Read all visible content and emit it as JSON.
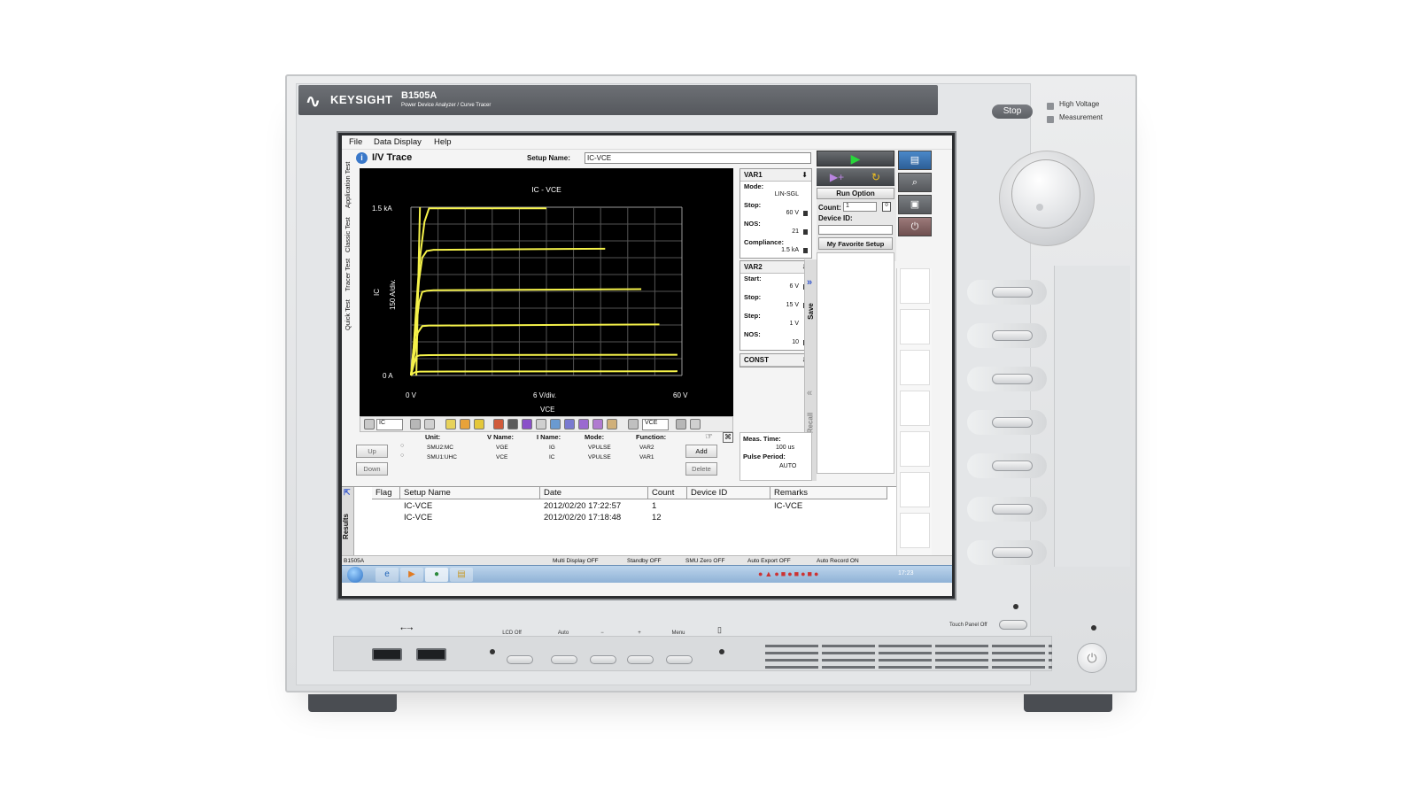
{
  "device": {
    "brand": "KEYSIGHT",
    "model": "B1505A",
    "model_desc": "Power Device Analyzer / Curve Tracer",
    "stop_label": "Stop",
    "hv_label_1": "High Voltage",
    "hv_label_2": "Measurement",
    "bottom_labels": [
      "LCD Off",
      "Auto",
      "−",
      "+",
      "Menu"
    ],
    "touch_panel_label": "Touch Panel Off",
    "usb_symbol": "⭠⭢"
  },
  "menu": [
    "File",
    "Data Display",
    "Help"
  ],
  "side_tabs": [
    "Application Test",
    "Classic Test",
    "Tracer Test",
    "Quick Test"
  ],
  "app": {
    "title": "I/V Trace",
    "setup_name_label": "Setup Name:",
    "setup_name_value": "IC-VCE"
  },
  "var1": {
    "header": "VAR1",
    "mode_label": "Mode:",
    "mode_value": "LIN-SGL",
    "stop_label": "Stop:",
    "stop_value": "60 V",
    "nos_label": "NOS:",
    "nos_value": "21",
    "compliance_label": "Compliance:",
    "compliance_value": "1.5 kA"
  },
  "var2": {
    "header": "VAR2",
    "start_label": "Start:",
    "start_value": "6 V",
    "stop_label": "Stop:",
    "stop_value": "15 V",
    "step_label": "Step:",
    "step_value": "1 V",
    "nos_label": "NOS:",
    "nos_value": "10"
  },
  "const_header": "CONST",
  "run": {
    "run_option": "Run Option",
    "count_label": "Count:",
    "count_value": "1",
    "count_box": "0",
    "device_id_label": "Device ID:",
    "favorite": "My Favorite Setup"
  },
  "save_label": "Save",
  "recall_label": "Recall",
  "toolbar": {
    "y_select": "IC",
    "x_select": "VCE"
  },
  "smu": {
    "headers": {
      "unit": "Unit:",
      "vname": "V Name:",
      "iname": "I Name:",
      "mode": "Mode:",
      "function": "Function:"
    },
    "rows": [
      {
        "unit": "SMU2:MC",
        "vname": "VGE",
        "iname": "IG",
        "mode": "VPULSE",
        "function": "VAR2"
      },
      {
        "unit": "SMU1:UHC",
        "vname": "VCE",
        "iname": "IC",
        "mode": "VPULSE",
        "function": "VAR1"
      }
    ],
    "up": "Up",
    "down": "Down",
    "add": "Add",
    "delete": "Delete"
  },
  "meas": {
    "time_label": "Meas. Time:",
    "time_value": "100 us",
    "period_label": "Pulse Period:",
    "period_value": "AUTO"
  },
  "results": {
    "side_label": "Results",
    "columns": [
      "Flag",
      "Setup Name",
      "Date",
      "Count",
      "Device ID",
      "Remarks"
    ],
    "rows": [
      {
        "flag": "",
        "setup": "IC-VCE",
        "date": "2012/02/20 17:22:57",
        "count": "1",
        "device": "",
        "remarks": "IC-VCE"
      },
      {
        "flag": "",
        "setup": "IC-VCE",
        "date": "2012/02/20 17:18:48",
        "count": "12",
        "device": "",
        "remarks": ""
      }
    ]
  },
  "status": {
    "left": "B1505A",
    "items": [
      "Multi Display OFF",
      "Standby OFF",
      "SMU Zero OFF",
      "Auto Export OFF",
      "Auto Record ON"
    ]
  },
  "taskbar": {
    "clock": "17:23"
  },
  "chart_data": {
    "type": "line",
    "title": "IC - VCE",
    "xlabel": "VCE",
    "ylabel": "IC",
    "y_scale_label": "150 A/div.",
    "x_scale_label": "6 V/div.",
    "x_tick_labels": [
      "0 V",
      "60 V"
    ],
    "y_tick_labels": [
      "0 A",
      "1.5 kA"
    ],
    "xlim": [
      0,
      60
    ],
    "ylim": [
      0,
      1500
    ],
    "grid": true,
    "background": "#000000",
    "line_color": "#f5f24a",
    "series": [
      {
        "x": [
          0,
          0.6,
          1.0,
          1.5,
          2,
          3,
          4,
          30
        ],
        "y": [
          0,
          250,
          500,
          800,
          1050,
          1370,
          1490,
          1490
        ]
      },
      {
        "x": [
          0,
          0.6,
          1.2,
          1.8,
          2.5,
          3.5,
          5,
          43
        ],
        "y": [
          0,
          250,
          550,
          850,
          1050,
          1110,
          1120,
          1130
        ]
      },
      {
        "x": [
          0,
          0.6,
          1.2,
          1.8,
          2.5,
          3.5,
          5,
          51
        ],
        "y": [
          0,
          200,
          450,
          650,
          745,
          755,
          760,
          770
        ]
      },
      {
        "x": [
          0,
          0.5,
          1.0,
          1.5,
          2.5,
          4,
          6,
          55
        ],
        "y": [
          0,
          120,
          250,
          380,
          440,
          445,
          445,
          455
        ]
      },
      {
        "x": [
          0,
          0.4,
          0.8,
          1.2,
          2,
          4,
          59
        ],
        "y": [
          0,
          60,
          120,
          170,
          180,
          182,
          185
        ]
      },
      {
        "x": [
          0,
          0.5,
          1,
          2,
          59
        ],
        "y": [
          0,
          20,
          30,
          35,
          38
        ]
      }
    ],
    "vertical_trace": {
      "x": [
        1.2,
        1.6,
        2.0
      ],
      "y": [
        0,
        800,
        1500
      ]
    }
  }
}
